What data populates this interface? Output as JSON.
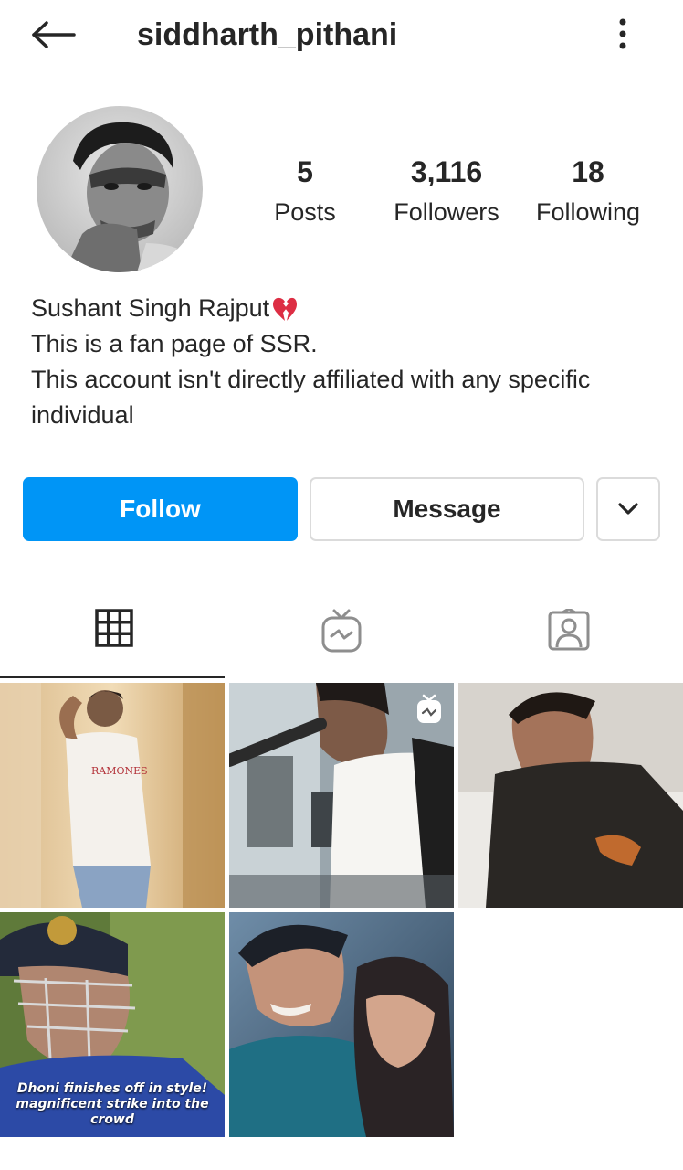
{
  "header": {
    "username": "siddharth_pithani",
    "back_icon": "arrow-left-icon",
    "more_icon": "more-vertical-icon"
  },
  "profile": {
    "avatar_icon": "profile-photo",
    "stats": {
      "posts": {
        "value": "5",
        "label": "Posts"
      },
      "followers": {
        "value": "3,116",
        "label": "Followers"
      },
      "following": {
        "value": "18",
        "label": "Following"
      }
    },
    "bio": {
      "name": "Sushant Singh Rajput",
      "line1": "This is a fan page of SSR.",
      "line2": "This account isn't directly affiliated with any specific",
      "line3": "individual"
    }
  },
  "actions": {
    "follow_label": "Follow",
    "message_label": "Message",
    "more_icon": "chevron-down-icon"
  },
  "tabs": [
    {
      "name": "grid",
      "icon": "grid-icon",
      "active": true
    },
    {
      "name": "igtv",
      "icon": "igtv-icon",
      "active": false
    },
    {
      "name": "tagged",
      "icon": "tagged-person-icon",
      "active": false
    }
  ],
  "posts": [
    {
      "caption": ""
    },
    {
      "caption": "",
      "badge": "igtv-icon"
    },
    {
      "caption": ""
    },
    {
      "caption_line1": "Dhoni finishes off in style!",
      "caption_line2": "magnificent strike into the crowd"
    },
    {
      "caption": ""
    }
  ],
  "colors": {
    "accent": "#0095f6",
    "text": "#262626",
    "border": "#dbdbdb"
  }
}
